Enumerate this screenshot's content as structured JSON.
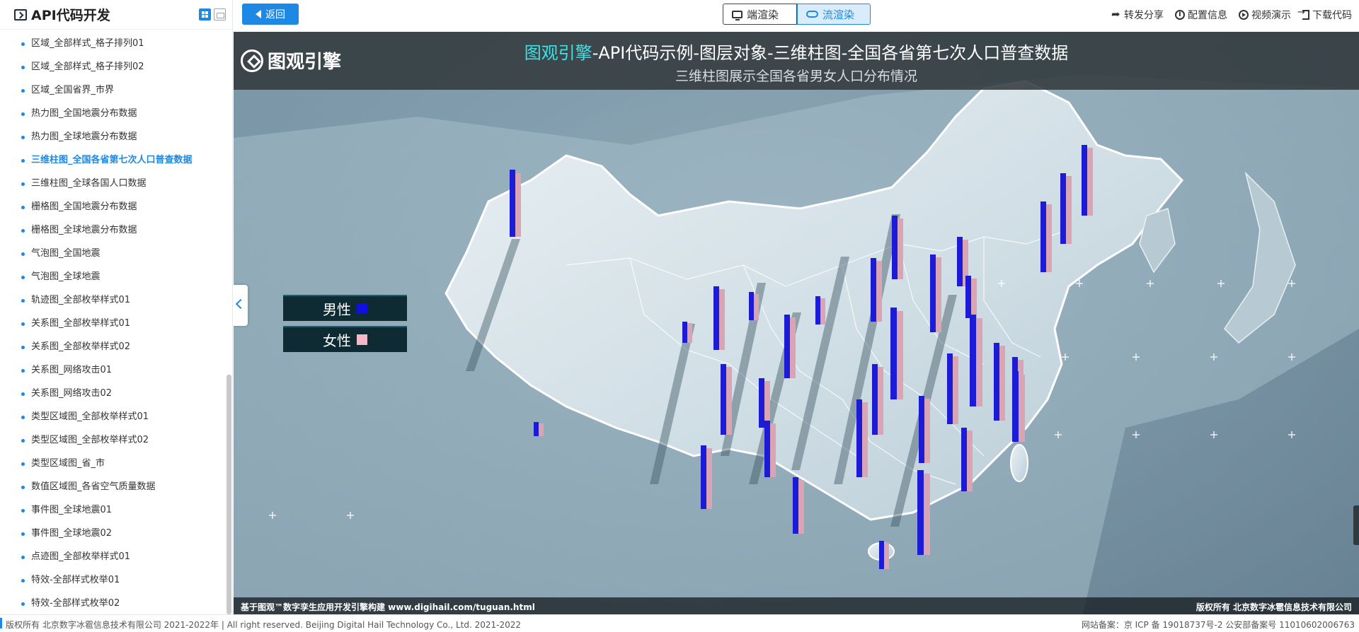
{
  "sidebar": {
    "title": "API代码开发",
    "items": [
      {
        "label": "区域_全部样式_格子排列01",
        "active": false
      },
      {
        "label": "区域_全部样式_格子排列02",
        "active": false
      },
      {
        "label": "区域_全国省界_市界",
        "active": false
      },
      {
        "label": "热力图_全国地震分布数据",
        "active": false
      },
      {
        "label": "热力图_全球地震分布数据",
        "active": false
      },
      {
        "label": "三维柱图_全国各省第七次人口普查数据",
        "active": true
      },
      {
        "label": "三维柱图_全球各国人口数据",
        "active": false
      },
      {
        "label": "栅格图_全国地震分布数据",
        "active": false
      },
      {
        "label": "栅格图_全球地震分布数据",
        "active": false
      },
      {
        "label": "气泡图_全国地震",
        "active": false
      },
      {
        "label": "气泡图_全球地震",
        "active": false
      },
      {
        "label": "轨迹图_全部枚举样式01",
        "active": false
      },
      {
        "label": "关系图_全部枚举样式01",
        "active": false
      },
      {
        "label": "关系图_全部枚举样式02",
        "active": false
      },
      {
        "label": "关系图_网络攻击01",
        "active": false
      },
      {
        "label": "关系图_网络攻击02",
        "active": false
      },
      {
        "label": "类型区域图_全部枚举样式01",
        "active": false
      },
      {
        "label": "类型区域图_全部枚举样式02",
        "active": false
      },
      {
        "label": "类型区域图_省_市",
        "active": false
      },
      {
        "label": "数值区域图_各省空气质量数据",
        "active": false
      },
      {
        "label": "事件图_全球地震01",
        "active": false
      },
      {
        "label": "事件图_全球地震02",
        "active": false
      },
      {
        "label": "点迹图_全部枚举样式01",
        "active": false
      },
      {
        "label": "特效-全部样式枚举01",
        "active": false
      },
      {
        "label": "特效-全部样式枚举02",
        "active": false
      }
    ]
  },
  "toolbar": {
    "back_label": "返回",
    "local_render_label": "端渲染",
    "stream_render_label": "流渲染",
    "share_label": "转发分享",
    "config_label": "配置信息",
    "video_label": "视频演示",
    "download_label": "下载代码"
  },
  "viewport": {
    "logo_text": "图观引擎",
    "title_highlight": "图观引擎",
    "title_rest": "-API代码示例-图层对象-三维柱图-全国各省第七次人口普查数据",
    "subtitle": "三维柱图展示全国各省男女人口分布情况",
    "legend": {
      "male_label": "男性",
      "female_label": "女性",
      "male_color": "#0f0fe0",
      "female_color": "#f2b8c6"
    },
    "footer_left": "基于图观™数字孪生应用开发引擎构建 www.digihail.com/tuguan.html",
    "footer_right": "版权所有 北京数字冰雹信息技术有限公司"
  },
  "page_footer": {
    "left": "版权所有 北京数字冰雹信息技术有限公司 2021-2022年 | All right reserved. Beijing Digital Hail Technology Co., Ltd. 2021-2022",
    "right": "网站备案：京 ICP 备 19018737号-2 公安部备案号 11010602006763"
  }
}
